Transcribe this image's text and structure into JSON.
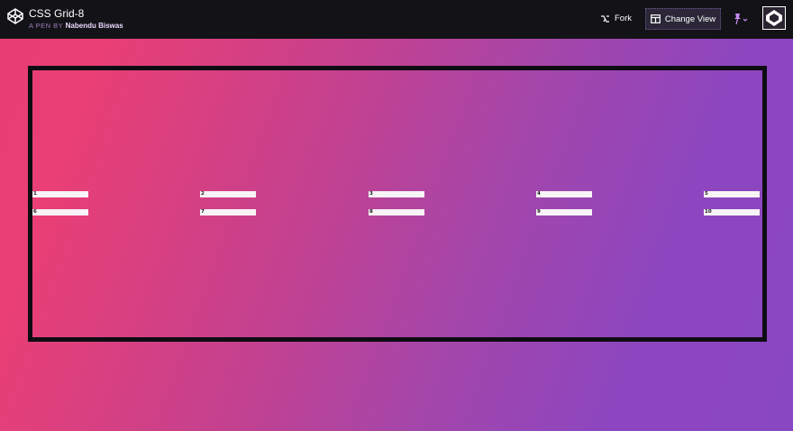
{
  "header": {
    "title": "CSS Grid-8",
    "byline_prefix": "A PEN BY",
    "author": "Nabendu Biswas",
    "fork_label": "Fork",
    "change_view_label": "Change View"
  },
  "grid": {
    "items": [
      "1",
      "2",
      "3",
      "4",
      "5",
      "6",
      "7",
      "8",
      "9",
      "10"
    ]
  },
  "colors": {
    "gradient_start": "#e83e73",
    "gradient_end": "#8a47c2",
    "topbar": "#131216",
    "frame": "#0e0c12"
  },
  "icons": [
    "codepen-logo-icon",
    "fork-icon",
    "layout-icon",
    "pin-icon",
    "chevron-down-icon",
    "avatar"
  ]
}
